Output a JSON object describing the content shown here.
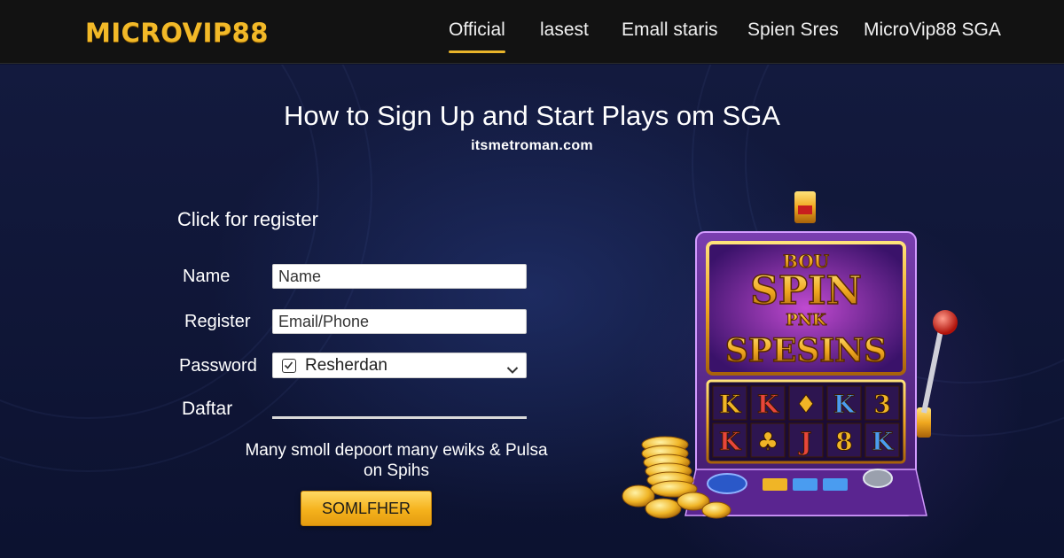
{
  "header": {
    "logo": "MICROVIP88",
    "nav": [
      {
        "label": "Official",
        "active": true
      },
      {
        "label": "lasest",
        "active": false
      },
      {
        "label": "Emall staris",
        "active": false
      },
      {
        "label": "Spien Sres",
        "active": false
      },
      {
        "label": "MicroVip88 SGA",
        "active": false
      }
    ]
  },
  "main": {
    "title": "How to Sign Up and Start Plays om SGA",
    "site_url": "itsmetroman.com",
    "form": {
      "heading": "Click for register",
      "name_label": "Name",
      "name_placeholder": "Name",
      "register_label": "Register",
      "register_placeholder": "Email/Phone",
      "password_label": "Password",
      "password_value": "Resherdan",
      "daftar_label": "Daftar",
      "promo_line1": "Many smoll depoort many ewiks & Pulsa",
      "promo_line2": "on Spihs",
      "submit_label": "SOMLFHER"
    },
    "slot_machine": {
      "sign_line1": "BOU",
      "sign_line2": "SPIN",
      "sign_line3": "PNK",
      "sign_line4": "SPESINS",
      "reels_row1": [
        "K",
        "K",
        "♦",
        "K",
        "3"
      ],
      "reels_row2": [
        "K",
        "♣",
        "J",
        "8",
        "K"
      ]
    }
  },
  "colors": {
    "accent": "#f2b928",
    "background": "#0d1330",
    "header_bg": "#121212",
    "cta": "#f5b21c"
  }
}
